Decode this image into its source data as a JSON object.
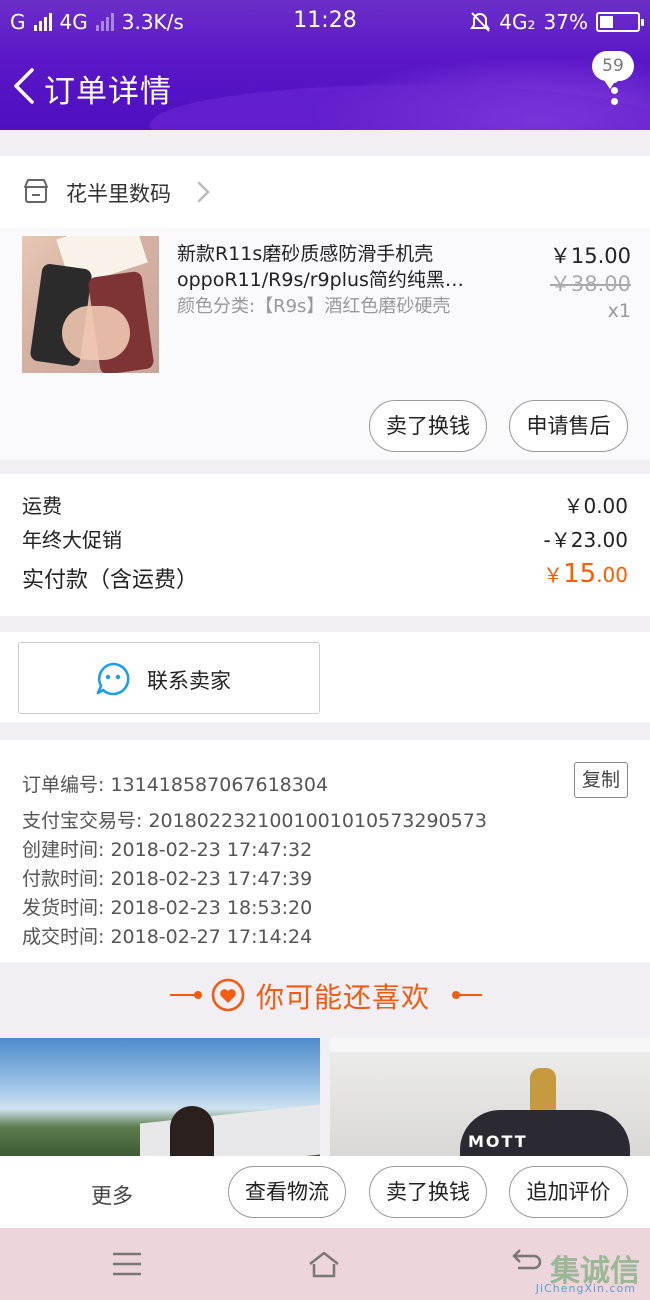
{
  "status_bar": {
    "carrier": "G",
    "network_left": "4G",
    "speed": "3.3K/s",
    "time": "11:28",
    "network_right": "4G₂",
    "battery": "37%",
    "battery_level": 0.37
  },
  "header": {
    "title": "订单详情",
    "badge_count": "59"
  },
  "shop": {
    "name": "花半里数码",
    "item": {
      "title_line1": "新款R11s磨砂质感防滑手机壳",
      "title_line2": "oppoR11/R9s/r9plus简约纯黑…",
      "spec": "颜色分类:【R9s】酒红色磨砂硬壳",
      "price": "￥15.00",
      "original_price": "￥38.00",
      "quantity": "x1"
    },
    "buttons": [
      "卖了换钱",
      "申请售后"
    ]
  },
  "cost": {
    "shipping_label": "运费",
    "shipping_value": "￥0.00",
    "promo_label": "年终大促销",
    "promo_value": "-￥23.00",
    "paid_label": "实付款（含运费）",
    "paid_currency": "￥",
    "paid_int": "15",
    "paid_dec": ".00"
  },
  "contact": {
    "label": "联系卖家"
  },
  "order_info": {
    "copy_label": "复制",
    "lines": [
      "订单编号: 131418587067618304",
      "支付宝交易号: 2018022321001001010573290573",
      "创建时间: 2018-02-23 17:47:32",
      "付款时间: 2018-02-23 17:47:39",
      "发货时间: 2018-02-23 18:53:20",
      "成交时间: 2018-02-27 17:14:24"
    ]
  },
  "recommend": {
    "title": "你可能还喜欢",
    "shirt_text": "MOTT"
  },
  "action_bar": {
    "more": "更多",
    "buttons": [
      "查看物流",
      "卖了换钱",
      "追加评价"
    ]
  },
  "watermark": {
    "main": "集诚信",
    "sub": "JiChengXin.com"
  },
  "colors": {
    "header_purple": "#5b17c8",
    "price_orange": "#ff5b00",
    "recommend_orange": "#f35b10"
  }
}
